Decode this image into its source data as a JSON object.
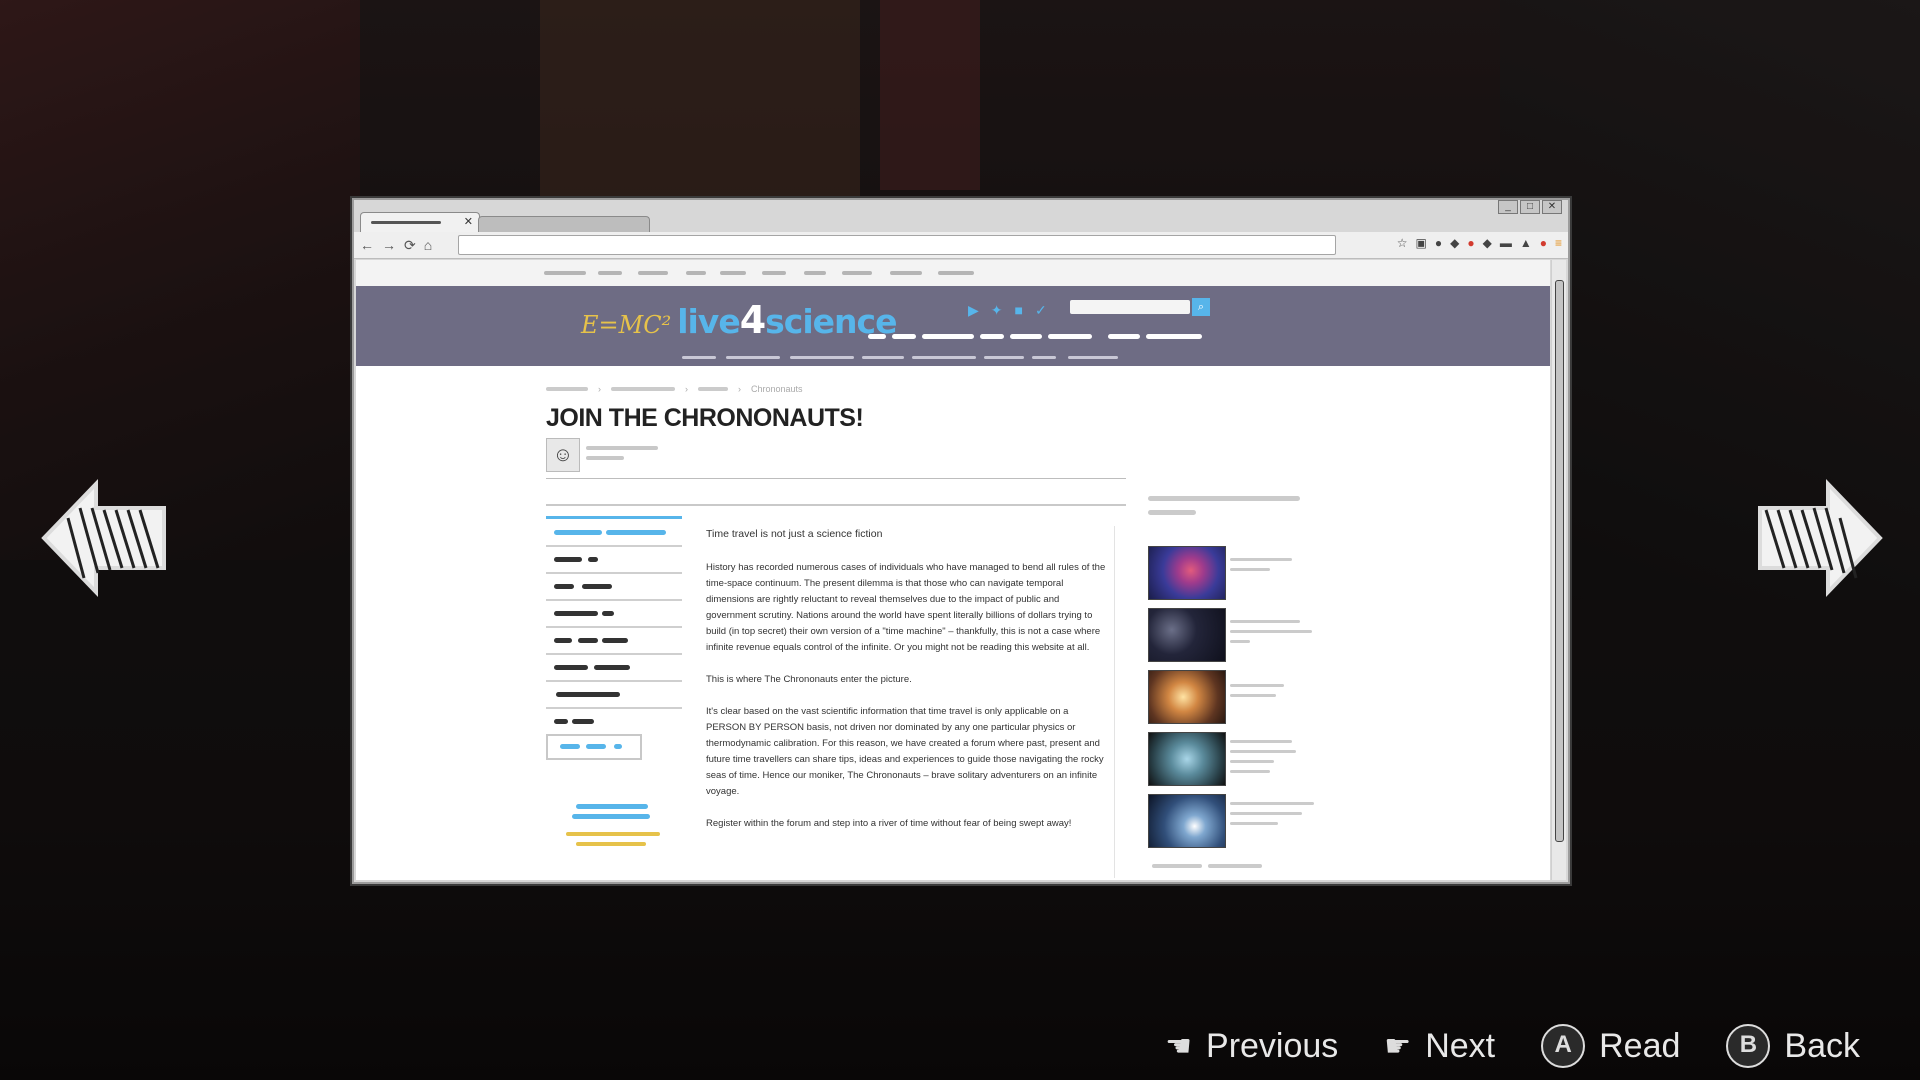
{
  "browser": {
    "window_controls": [
      "_",
      "□",
      "✕"
    ],
    "tab_close": "✕",
    "nav_icons": [
      "←",
      "→",
      "⟳",
      "⌂"
    ]
  },
  "site": {
    "logo_formula": "E=MC²",
    "logo_name_left": "live",
    "logo_four": "4",
    "logo_name_right": "science",
    "search_icon": "⌕"
  },
  "page": {
    "breadcrumb_current": "Chrononauts",
    "title": "JOIN THE CHRONONAUTS!",
    "article": [
      "Time travel is not just a science fiction",
      "History has recorded numerous cases of individuals who have managed to bend all rules of the time-space continuum. The present dilemma is that those who can navigate temporal dimensions are rightly reluctant to reveal themselves due to the impact of public and government scrutiny. Nations around the world have spent literally billions of dollars trying to build (in top secret) their own version of a \"time machine\" – thankfully, this is not a case where infinite revenue equals control of the infinite. Or you might not be reading this website at all.",
      "This is where The Chrononauts enter the picture.",
      "It's clear based on the vast scientific information that time travel is only applicable on a PERSON BY PERSON basis, not driven nor dominated by any one particular physics or thermodynamic calibration. For this reason, we have created a forum where past, present and future time travellers can share tips, ideas and experiences to guide those navigating the rocky seas of time. Hence our moniker, The Chrononauts – brave solitary adventurers on an infinite voyage.",
      "Register within the forum and step into a river of time without fear of being swept away!"
    ]
  },
  "prompts": {
    "previous_label": "Previous",
    "next_label": "Next",
    "read_button": "A",
    "read_label": "Read",
    "back_button": "B",
    "back_label": "Back"
  },
  "icons": {
    "arrow_left": "left-arrow-icon",
    "arrow_right": "right-arrow-icon",
    "hand_left": "☚",
    "hand_right": "☛"
  },
  "colors": {
    "site_header": "#6e6c84",
    "logo_blue": "#57b5ea",
    "logo_yellow": "#e6c24a"
  }
}
